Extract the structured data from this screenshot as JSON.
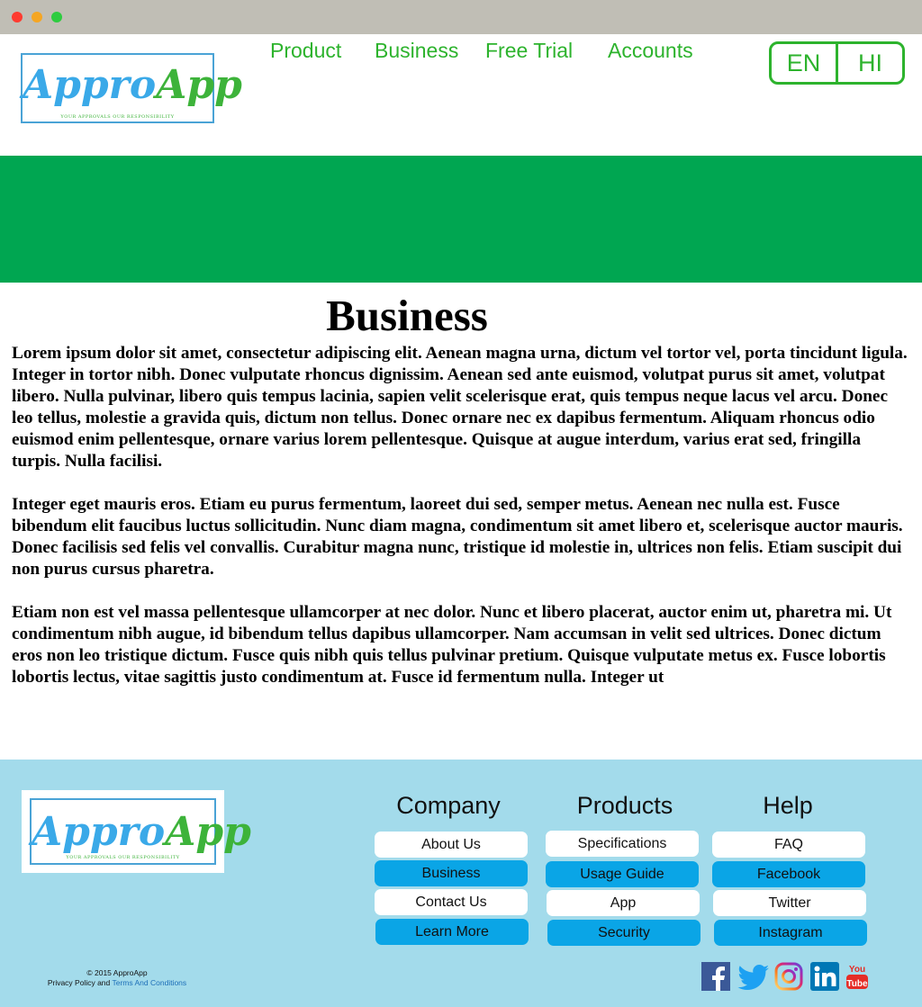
{
  "header": {
    "logo": {
      "name_part1": "Appro",
      "name_part2": "App",
      "tagline": "YOUR APPROVALS OUR RESPONSIBILITY"
    },
    "nav": [
      "Product",
      "Business",
      "Free Trial",
      "Accounts"
    ],
    "languages": [
      "EN",
      "HI"
    ]
  },
  "main": {
    "title": "Business",
    "paragraphs": [
      "Lorem ipsum dolor sit amet, consectetur adipiscing elit. Aenean magna urna, dictum vel tortor vel, porta tincidunt ligula. Integer in tortor nibh. Donec vulputate rhoncus dignissim. Aenean sed ante euismod, volutpat purus sit amet, volutpat libero. Nulla pulvinar, libero quis tempus lacinia, sapien velit scelerisque erat, quis tempus neque lacus vel arcu. Donec leo tellus, molestie a gravida quis, dictum non tellus. Donec ornare nec ex dapibus fermentum. Aliquam rhoncus odio euismod enim pellentesque, ornare varius lorem pellentesque. Quisque at augue interdum, varius erat sed, fringilla turpis. Nulla facilisi.",
      "Integer eget mauris eros. Etiam eu purus fermentum, laoreet dui sed, semper metus. Aenean nec nulla est. Fusce bibendum elit faucibus luctus sollicitudin. Nunc diam magna, condimentum sit amet libero et, scelerisque auctor mauris. Donec facilisis sed felis vel convallis. Curabitur magna nunc, tristique id molestie in, ultrices non felis. Etiam suscipit dui non purus cursus pharetra.",
      "Etiam non est vel massa pellentesque ullamcorper at nec dolor. Nunc et libero placerat, auctor enim ut, pharetra mi. Ut condimentum nibh augue, id bibendum tellus dapibus ullamcorper. Nam accumsan in velit sed ultrices. Donec dictum eros non leo tristique dictum. Fusce quis nibh quis tellus pulvinar pretium. Quisque vulputate metus ex. Fusce lobortis lobortis lectus, vitae sagittis justo condimentum at. Fusce id fermentum nulla. Integer ut"
    ]
  },
  "footer": {
    "columns": {
      "company": {
        "title": "Company",
        "links": [
          "About Us",
          "Business",
          "Contact Us",
          "Learn More"
        ]
      },
      "products": {
        "title": "Products",
        "links": [
          "Specifications",
          "Usage Guide",
          "App",
          "Security"
        ]
      },
      "help": {
        "title": "Help",
        "links": [
          "FAQ",
          "Facebook",
          "Twitter",
          "Instagram"
        ]
      }
    },
    "copyright_line": "© 2015  ApproApp",
    "policy_text": "Privacy Policy and",
    "terms_link": "Terms And Conditions",
    "social": [
      {
        "icon": "facebook-icon",
        "color": "#3b5998"
      },
      {
        "icon": "twitter-icon",
        "color": "#1da1f2"
      },
      {
        "icon": "instagram-icon",
        "color": "#c13584"
      },
      {
        "icon": "linkedin-icon",
        "color": "#0077b5"
      },
      {
        "icon": "youtube-icon",
        "color": "#e52d27"
      }
    ]
  },
  "colors": {
    "brand_green": "#2db32d",
    "banner_green": "#00a651",
    "footer_bg": "#a3dbeb",
    "button_blue": "#0aa5e6"
  }
}
